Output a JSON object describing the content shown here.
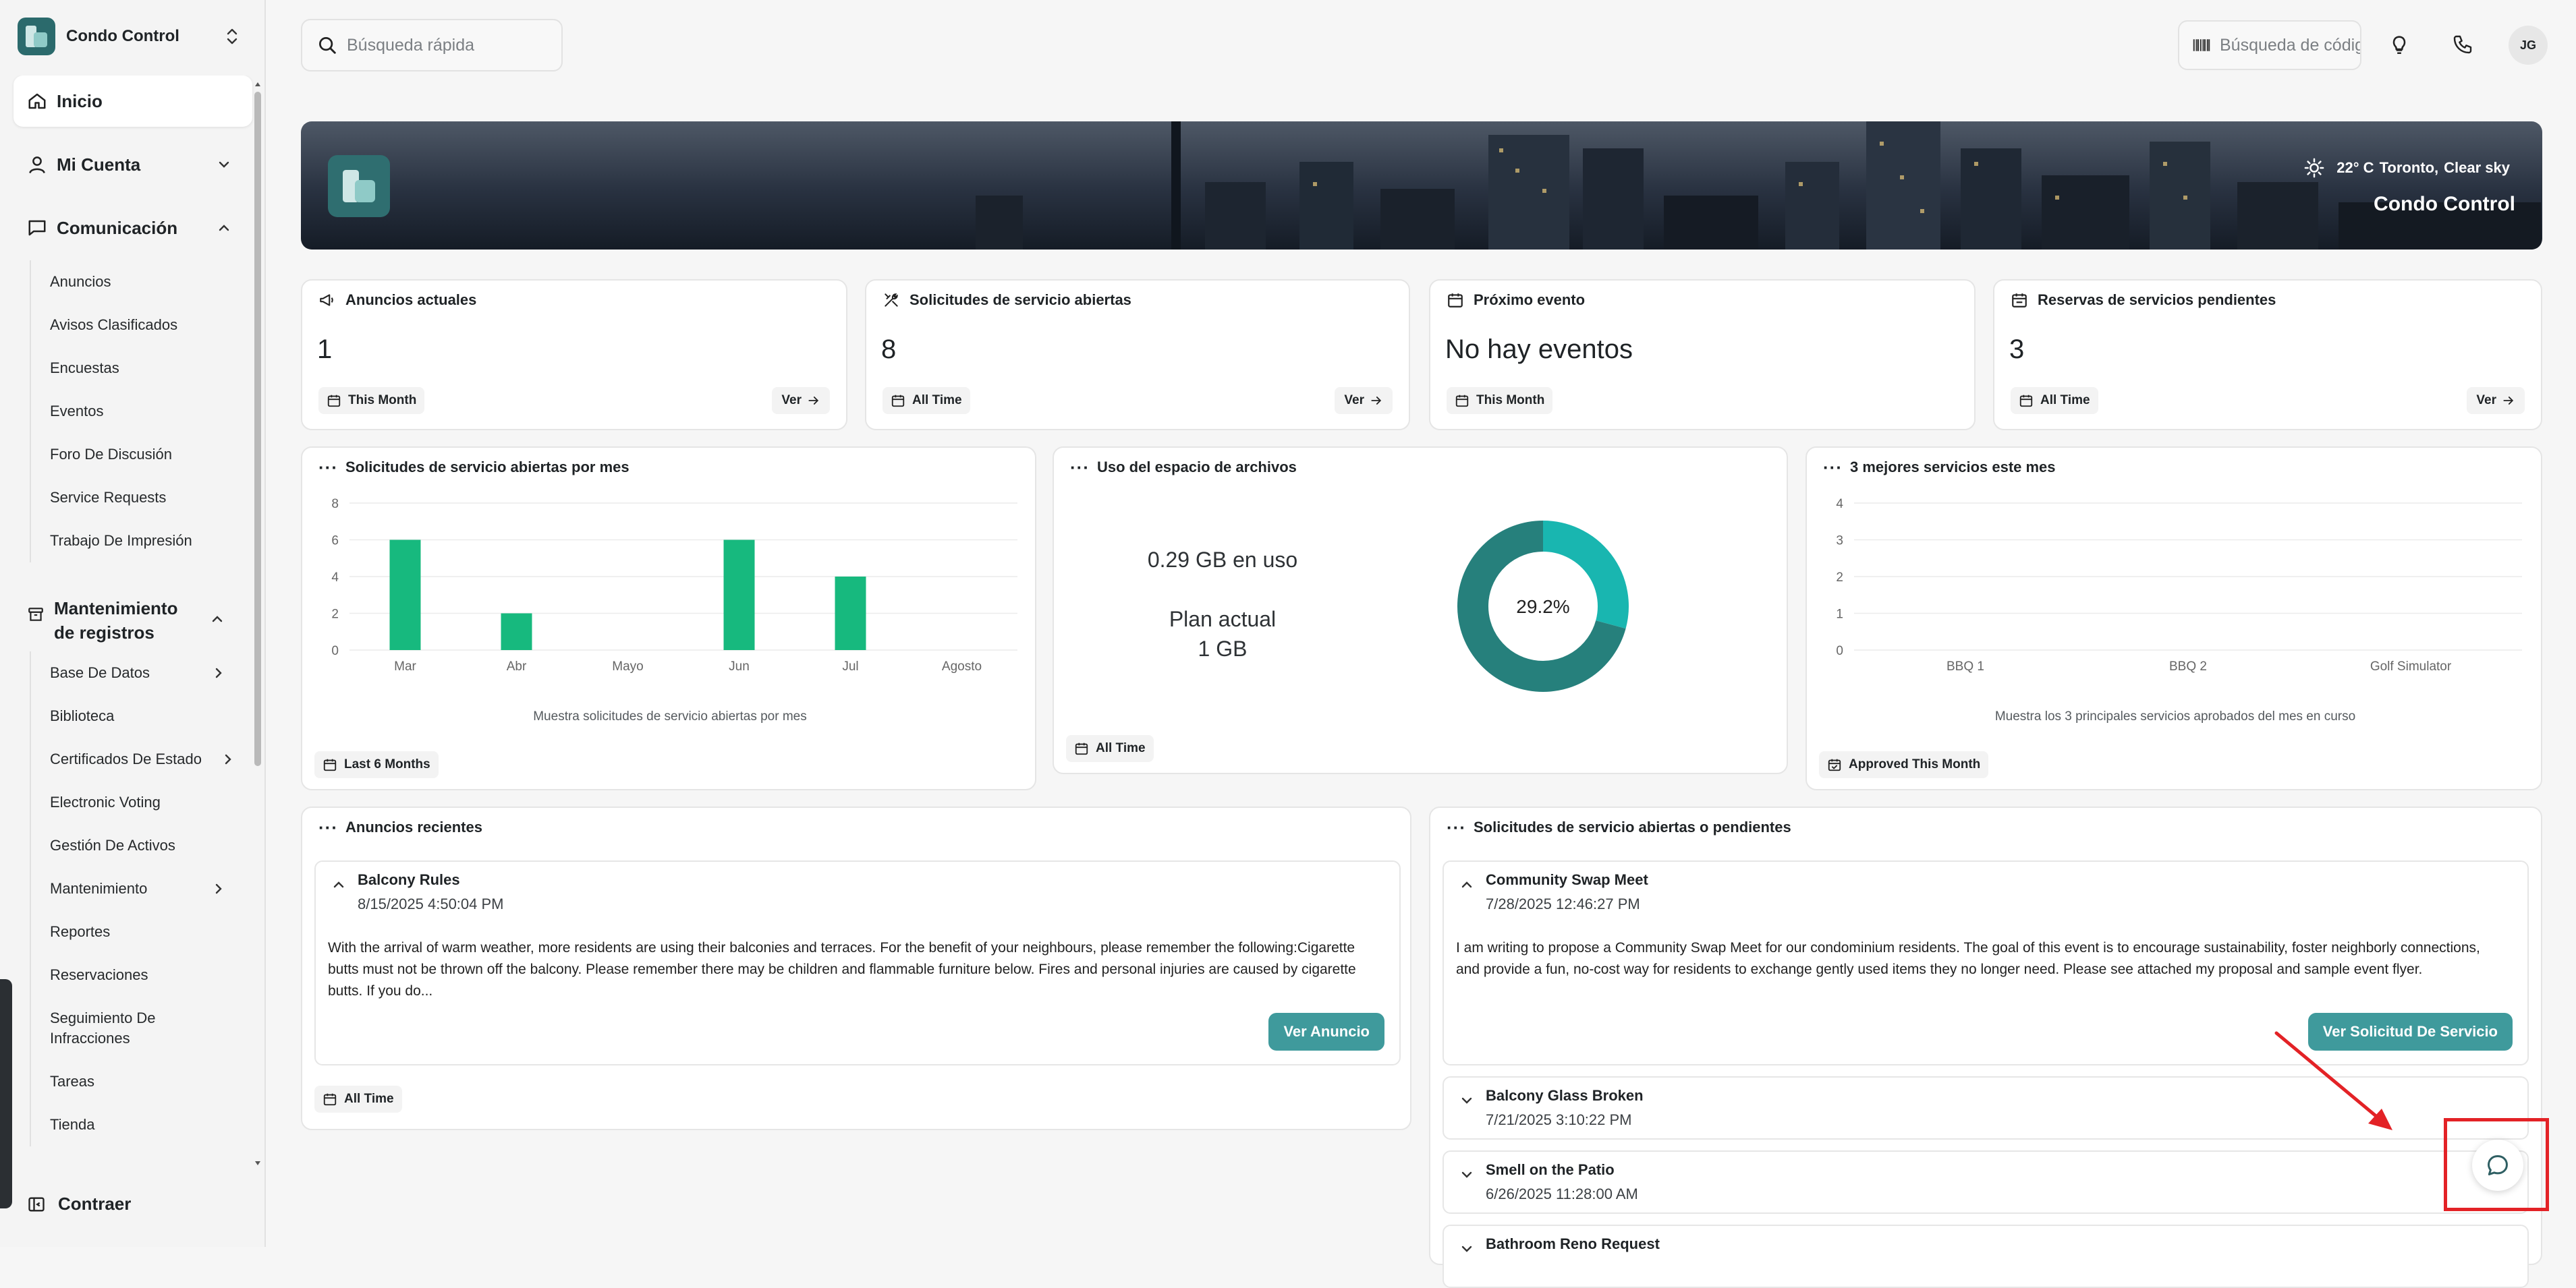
{
  "sidebar": {
    "brand": "Condo Control",
    "home": "Inicio",
    "account": "Mi Cuenta",
    "communication": {
      "label": "Comunicación",
      "items": [
        "Anuncios",
        "Avisos Clasificados",
        "Encuestas",
        "Eventos",
        "Foro De Discusión",
        "Service Requests",
        "Trabajo De Impresión"
      ]
    },
    "records": {
      "label_line1": "Mantenimiento",
      "label_line2": "de registros",
      "items": [
        {
          "label": "Base De Datos",
          "has_submenu": true
        },
        {
          "label": "Biblioteca",
          "has_submenu": false
        },
        {
          "label": "Certificados De Estado",
          "has_submenu": true
        },
        {
          "label": "Electronic Voting",
          "has_submenu": false
        },
        {
          "label": "Gestión De Activos",
          "has_submenu": false
        },
        {
          "label": "Mantenimiento",
          "has_submenu": true
        },
        {
          "label": "Reportes",
          "has_submenu": false
        },
        {
          "label": "Reservaciones",
          "has_submenu": false
        },
        {
          "label": "Seguimiento De Infracciones",
          "has_submenu": false
        },
        {
          "label": "Tareas",
          "has_submenu": false
        },
        {
          "label": "Tienda",
          "has_submenu": false
        }
      ]
    },
    "collapse": "Contraer"
  },
  "topbar": {
    "search_placeholder": "Búsqueda rápida",
    "barcode_placeholder": "Búsqueda de código",
    "avatar": "JG"
  },
  "banner": {
    "temperature": "22° C",
    "city": "Toronto,",
    "condition": "Clear sky",
    "title": "Condo Control"
  },
  "stats": [
    {
      "title": "Anuncios actuales",
      "value": "1",
      "period": "This Month",
      "link": "Ver"
    },
    {
      "title": "Solicitudes de servicio abiertas",
      "value": "8",
      "period": "All Time",
      "link": "Ver"
    },
    {
      "title": "Próximo evento",
      "value": "No hay eventos",
      "period": "This Month",
      "link": ""
    },
    {
      "title": "Reservas de servicios pendientes",
      "value": "3",
      "period": "All Time",
      "link": "Ver"
    }
  ],
  "widgets": {
    "requests_chart": {
      "title": "Solicitudes de servicio abiertas por mes",
      "period": "Last 6 Months"
    },
    "file_space": {
      "title": "Uso del espacio de archivos",
      "in_use": "0.29 GB en uso",
      "plan_line1": "Plan actual",
      "plan_line2": "1 GB",
      "period": "All Time"
    },
    "top_services": {
      "title": "3 mejores servicios este mes",
      "period": "Approved This Month"
    }
  },
  "chart_data": [
    {
      "type": "bar",
      "categories": [
        "Mar",
        "Abr",
        "Mayo",
        "Jun",
        "Jul",
        "Agosto"
      ],
      "values": [
        6,
        2,
        0,
        6,
        4,
        0
      ],
      "ylim": [
        0,
        8
      ],
      "yticks": [
        0,
        2,
        4,
        6,
        8
      ],
      "xlabel": "Muestra solicitudes de servicio abiertas por mes",
      "color": "#17b97e",
      "grid": true
    },
    {
      "type": "pie",
      "categories": [
        "used",
        "free"
      ],
      "values": [
        29.2,
        70.8
      ],
      "center_label": "29.2%",
      "colors": [
        "#19b6b0",
        "#26807c"
      ]
    },
    {
      "type": "bar",
      "categories": [
        "BBQ 1",
        "BBQ 2",
        "Golf Simulator"
      ],
      "values": [
        0,
        0,
        0
      ],
      "ylim": [
        0,
        4
      ],
      "yticks": [
        0,
        1,
        2,
        3,
        4
      ],
      "xlabel": "Muestra los 3 principales servicios aprobados del mes en curso",
      "grid": true
    }
  ],
  "announcements": {
    "title": "Anuncios recientes",
    "period": "All Time",
    "items": [
      {
        "title": "Balcony Rules",
        "date": "8/15/2025 4:50:04 PM",
        "body": "With the arrival of warm weather, more residents are using their balconies and terraces. For the benefit of your neighbours, please remember the following:Cigarette butts must not be thrown off the balcony. Please remember there may be children and flammable furniture below. Fires and personal injuries are caused by cigarette butts. If you do...",
        "button": "Ver Anuncio"
      }
    ]
  },
  "service_requests": {
    "title": "Solicitudes de servicio abiertas o pendientes",
    "expanded": {
      "title": "Community Swap Meet",
      "date": "7/28/2025 12:46:27 PM",
      "body": "I am writing to propose a Community Swap Meet for our condominium residents. The goal of this event is to encourage sustainability, foster neighborly connections, and provide a fun, no-cost way for residents to exchange gently used items they no longer need. Please see attached my proposal and sample event flyer.",
      "button": "Ver Solicitud De Servicio"
    },
    "collapsed": [
      {
        "title": "Balcony Glass Broken",
        "date": "7/21/2025 3:10:22 PM"
      },
      {
        "title": "Smell on the Patio",
        "date": "6/26/2025 11:28:00 AM"
      },
      {
        "title": "Bathroom Reno Request",
        "date": ""
      }
    ]
  },
  "colors": {
    "accent": "#3f9a9c",
    "bar": "#17b97e",
    "annotation": "#e32226"
  }
}
